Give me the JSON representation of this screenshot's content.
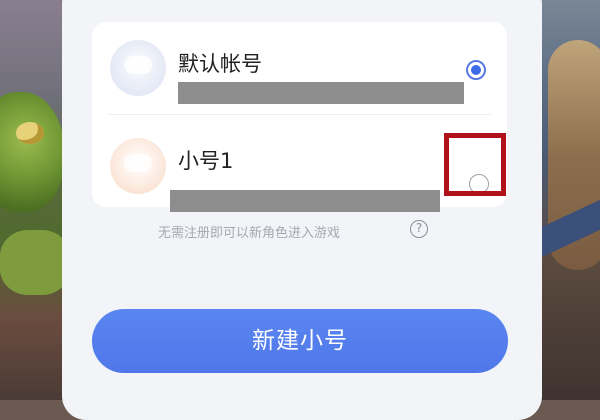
{
  "accounts": [
    {
      "name": "默认帐号",
      "selected": true
    },
    {
      "name": "小号1",
      "selected": false
    }
  ],
  "hint": {
    "text": "无需注册即可以新角色进入游戏",
    "help_icon_glyph": "?"
  },
  "create_button": {
    "label": "新建小号"
  },
  "colors": {
    "accent": "#4f77ea",
    "highlight": "#b0121b",
    "redaction": "#8d8d8d"
  }
}
